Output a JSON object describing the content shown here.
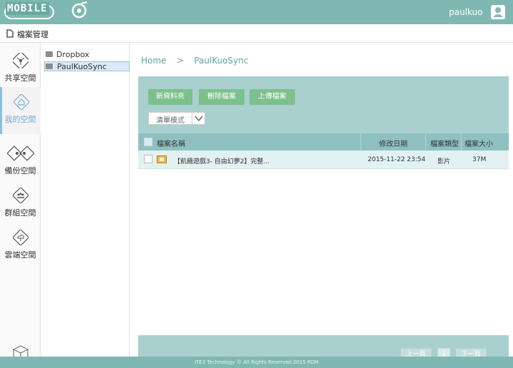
{
  "header": {
    "logo_text": "MOBILE",
    "username": "paulkuo"
  },
  "subheader": {
    "title": "檔案管理"
  },
  "leftnav": {
    "items": [
      {
        "label": "共享空間",
        "active": false
      },
      {
        "label": "我的空間",
        "active": true
      },
      {
        "label": "備份空間",
        "active": false
      },
      {
        "label": "群組空間",
        "active": false
      },
      {
        "label": "雲端空間",
        "active": false
      }
    ]
  },
  "tree": {
    "items": [
      {
        "label": "Dropbox",
        "selected": false
      },
      {
        "label": "PaulKuoSync",
        "selected": true
      }
    ]
  },
  "breadcrumb": {
    "home": "Home",
    "current": "PaulKuoSync"
  },
  "toolbar": {
    "new_folder": "新資料夾",
    "delete_file": "刪除檔案",
    "upload_file": "上傳檔案",
    "view_mode": "清單模式"
  },
  "table": {
    "headers": {
      "name": "檔案名稱",
      "modified": "修改日期",
      "type": "檔案類型",
      "size": "檔案大小"
    },
    "rows": [
      {
        "name": "【飢餓遊戲3- 自由幻夢2】完整...",
        "modified": "2015-11-22 23:54",
        "type": "影片",
        "size": "37M"
      }
    ]
  },
  "pager": {
    "prev": "上一頁",
    "page": "1",
    "next": "下一頁"
  },
  "footer": {
    "text": "ITE2 Technology © All Rights Reserved 2015 PDM"
  },
  "colors": {
    "header_bg": "#7fb8b2",
    "panel_bg": "#a9cfcf",
    "button_green": "#7cc08c",
    "link_teal": "#5aa3a6",
    "active_nav": "#7aa8d8"
  },
  "icons": {
    "user": "user-icon",
    "file_mgmt": "document-icon",
    "folder": "folder-icon",
    "video": "video-file-icon",
    "chevron": "chevron-down-icon"
  }
}
